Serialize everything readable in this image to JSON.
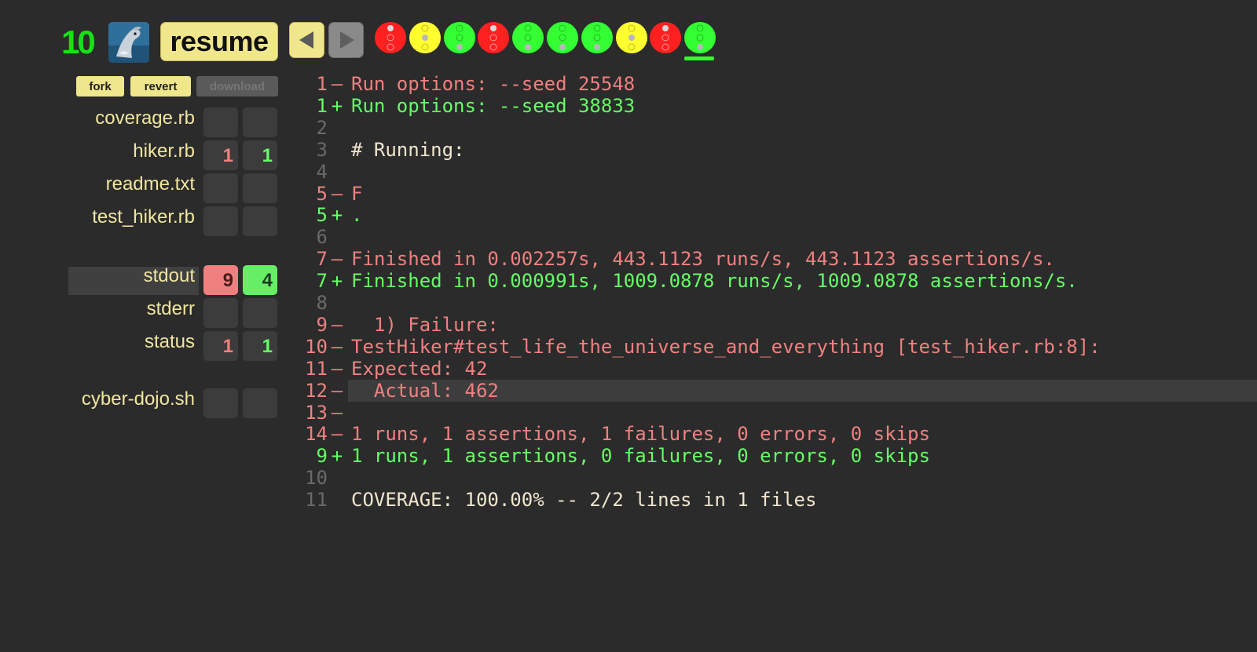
{
  "topbar": {
    "avatar_count": "10",
    "resume_label": "resume",
    "lights": [
      {
        "color": "#ff2020",
        "type": "red"
      },
      {
        "color": "#ffff30",
        "type": "amber"
      },
      {
        "color": "#33ff33",
        "type": "green"
      },
      {
        "color": "#ff2020",
        "type": "red"
      },
      {
        "color": "#33ff33",
        "type": "green"
      },
      {
        "color": "#33ff33",
        "type": "green"
      },
      {
        "color": "#33ff33",
        "type": "green"
      },
      {
        "color": "#ffff30",
        "type": "amber"
      },
      {
        "color": "#ff2020",
        "type": "red"
      },
      {
        "color": "#33ff33",
        "type": "green",
        "selected": true
      }
    ]
  },
  "sidebar": {
    "buttons": {
      "fork": "fork",
      "revert": "revert",
      "download": "download"
    },
    "files": [
      {
        "name": "coverage.rb",
        "deleted": "",
        "added": ""
      },
      {
        "name": "hiker.rb",
        "deleted": "1",
        "added": "1"
      },
      {
        "name": "readme.txt",
        "deleted": "",
        "added": ""
      },
      {
        "name": "test_hiker.rb",
        "deleted": "",
        "added": ""
      }
    ],
    "outputs": [
      {
        "name": "stdout",
        "deleted": "9",
        "added": "4",
        "selected": true
      },
      {
        "name": "stderr",
        "deleted": "",
        "added": ""
      },
      {
        "name": "status",
        "deleted": "1",
        "added": "1"
      }
    ],
    "scripts": [
      {
        "name": "cyber-dojo.sh",
        "deleted": "",
        "added": ""
      }
    ]
  },
  "diff": {
    "lines": [
      {
        "num": "1",
        "sign": "–",
        "kind": "deleted",
        "text": "Run options: --seed 25548"
      },
      {
        "num": "1",
        "sign": "+",
        "kind": "added",
        "text": "Run options: --seed 38833"
      },
      {
        "num": "2",
        "sign": "",
        "kind": "same",
        "text": ""
      },
      {
        "num": "3",
        "sign": "",
        "kind": "same",
        "text": "# Running:"
      },
      {
        "num": "4",
        "sign": "",
        "kind": "same",
        "text": ""
      },
      {
        "num": "5",
        "sign": "–",
        "kind": "deleted",
        "text": "F"
      },
      {
        "num": "5",
        "sign": "+",
        "kind": "added",
        "text": "."
      },
      {
        "num": "6",
        "sign": "",
        "kind": "same",
        "text": ""
      },
      {
        "num": "7",
        "sign": "–",
        "kind": "deleted",
        "text": "Finished in 0.002257s, 443.1123 runs/s, 443.1123 assertions/s."
      },
      {
        "num": "7",
        "sign": "+",
        "kind": "added",
        "text": "Finished in 0.000991s, 1009.0878 runs/s, 1009.0878 assertions/s."
      },
      {
        "num": "8",
        "sign": "",
        "kind": "same",
        "text": ""
      },
      {
        "num": "9",
        "sign": "–",
        "kind": "deleted",
        "text": "  1) Failure:"
      },
      {
        "num": "10",
        "sign": "–",
        "kind": "deleted",
        "text": "TestHiker#test_life_the_universe_and_everything [test_hiker.rb:8]:"
      },
      {
        "num": "11",
        "sign": "–",
        "kind": "deleted",
        "text": "Expected: 42"
      },
      {
        "num": "12",
        "sign": "–",
        "kind": "deleted",
        "text": "  Actual: 462",
        "highlight": true
      },
      {
        "num": "13",
        "sign": "–",
        "kind": "deleted",
        "text": ""
      },
      {
        "num": "14",
        "sign": "–",
        "kind": "deleted",
        "text": "1 runs, 1 assertions, 1 failures, 0 errors, 0 skips"
      },
      {
        "num": "9",
        "sign": "+",
        "kind": "added",
        "text": "1 runs, 1 assertions, 0 failures, 0 errors, 0 skips"
      },
      {
        "num": "10",
        "sign": "",
        "kind": "same",
        "text": ""
      },
      {
        "num": "11",
        "sign": "",
        "kind": "same",
        "text": "COVERAGE: 100.00% -- 2/2 lines in 1 files"
      }
    ]
  }
}
